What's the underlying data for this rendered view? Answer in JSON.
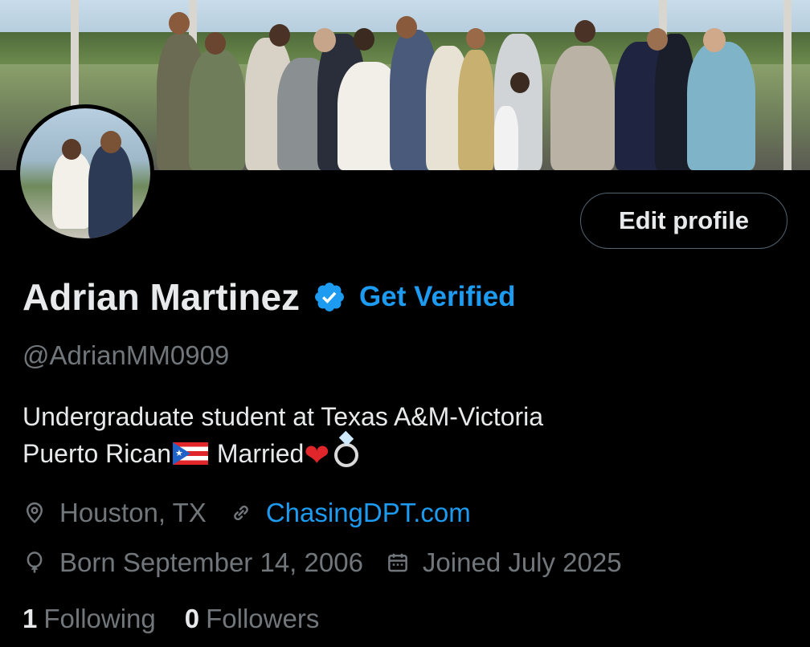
{
  "profile": {
    "name": "Adrian Martinez",
    "verified_label": "Get Verified",
    "handle": "@AdrianMM0909",
    "edit_button": "Edit profile",
    "bio_line_1": "Undergraduate student at Texas A&M-Victoria",
    "bio_line_2_text": "Puerto Rican",
    "bio_line_2_married": " Married",
    "location": "Houston, TX",
    "website": "ChasingDPT.com",
    "birthday": "Born September 14, 2006",
    "joined": "Joined July 2025",
    "following_count": "1",
    "following_label": "Following",
    "followers_count": "0",
    "followers_label": "Followers"
  },
  "colors": {
    "accent": "#1d9bf0",
    "background": "#000000",
    "text_primary": "#e7e9ea",
    "text_secondary": "#71767b",
    "border": "#536471"
  },
  "icons": {
    "verified": "verified-badge-icon",
    "location": "location-pin-icon",
    "link": "link-icon",
    "birthday": "balloon-icon",
    "calendar": "calendar-icon"
  }
}
